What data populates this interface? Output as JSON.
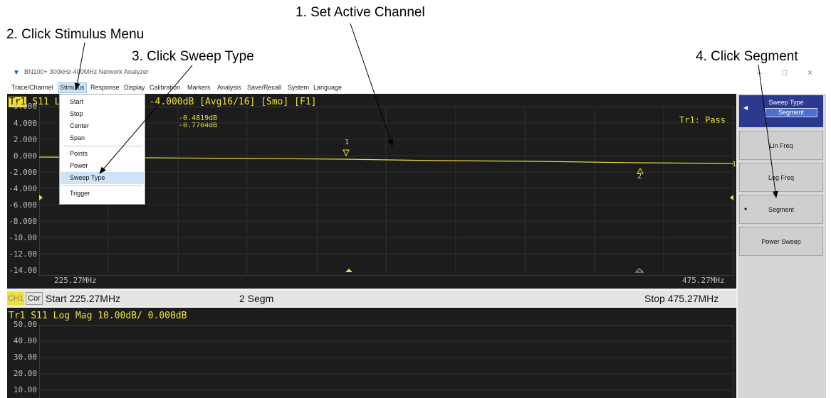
{
  "annotations": {
    "step1": "1. Set Active Channel",
    "step2": "2. Click Stimulus Menu",
    "step3": "3. Click Sweep Type",
    "step4": "4. Click Segment"
  },
  "window": {
    "title": "BN100+ 300kHz-400MHz Network Analyzer",
    "minimize": "–",
    "maximize": "□",
    "close": "×"
  },
  "menubar": [
    "Trace/Channel",
    "Stimulus",
    "Response",
    "Display",
    "Calibration",
    "Markers",
    "Analysis",
    "Save/Recall",
    "System",
    "Language"
  ],
  "stimulus_menu": [
    "Start",
    "Stop",
    "Center",
    "Span",
    "Points",
    "Power",
    "Sweep Type",
    "Trigger"
  ],
  "top_trace": {
    "tr_label": "Tr1",
    "header": " S11 Log Mag 2.000dB/ -4.000dB [Avg16/16] [Smo]  [F1]",
    "marker_readout_1": "-0.4819dB",
    "marker_readout_2": "-0.7704dB",
    "pass_text": "Tr1: Pass",
    "y_ticks": [
      "6.000",
      "4.000",
      "2.000",
      "0.000",
      "-2.000",
      "-4.000",
      "-6.000",
      "-8.000",
      "-10.00",
      "-12.00",
      "-14.00"
    ],
    "x_start": "225.27MHz",
    "x_stop": "475.27MHz",
    "marker1": "1",
    "marker2": "2",
    "ref_marker": "1",
    "trace_color": "#e8e03a"
  },
  "status": {
    "channel": "CH1",
    "cor": "Cor",
    "start": "Start 225.27MHz",
    "segments": "2 Segm",
    "stop": "Stop 475.27MHz"
  },
  "bottom_trace": {
    "header": "Tr1 S11 Log Mag 10.00dB/ 0.000dB",
    "y_ticks": [
      "50.00",
      "40.00",
      "30.00",
      "20.00",
      "10.00"
    ]
  },
  "softkeys": {
    "title": "Sweep Type",
    "value": "Segment",
    "lin_freq": "Lin Freq",
    "log_freq": "Log Freq",
    "segment": "Segment",
    "segment_bullet": "•",
    "power_sweep": "Power Sweep"
  }
}
